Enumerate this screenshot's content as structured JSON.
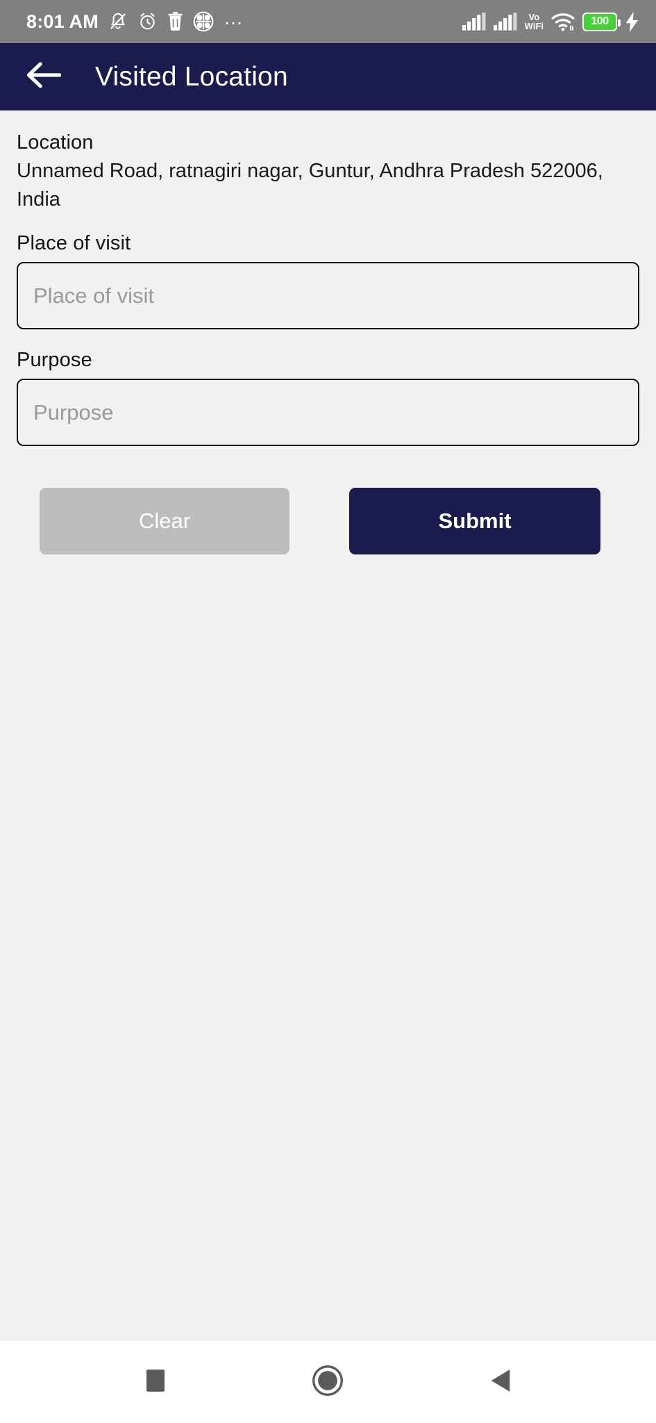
{
  "status_bar": {
    "time": "8:01 AM",
    "icons_left": [
      "bell-muted-icon",
      "alarm-clock-icon",
      "trash-icon",
      "app-grid-icon",
      "more-dots-icon"
    ],
    "icons_right": [
      "signal-bars-1-icon",
      "signal-bars-2-icon",
      "vowifi-icon",
      "wifi-icon",
      "battery-icon",
      "charging-bolt-icon"
    ],
    "vowifi_line1": "Vo",
    "vowifi_line2": "WiFi",
    "battery_level": "100",
    "background_color": "#808080"
  },
  "app_bar": {
    "back_icon": "arrow-left-icon",
    "title": "Visited Location",
    "background_color": "#1b1b4d"
  },
  "form": {
    "location_label": "Location",
    "location_value": "Unnamed Road, ratnagiri nagar, Guntur, Andhra Pradesh 522006, India",
    "place_label": "Place of visit",
    "place_placeholder": "Place of visit",
    "place_value": "",
    "purpose_label": "Purpose",
    "purpose_placeholder": "Purpose",
    "purpose_value": ""
  },
  "buttons": {
    "clear_label": "Clear",
    "clear_color": "#bdbdbd",
    "submit_label": "Submit",
    "submit_color": "#1b1b4d"
  },
  "nav_bar": {
    "recents_icon": "square-recents-icon",
    "home_icon": "circle-home-icon",
    "back_icon": "triangle-back-icon"
  },
  "theme": {
    "page_background": "#f1f1f1",
    "accent": "#1b1b4d"
  }
}
